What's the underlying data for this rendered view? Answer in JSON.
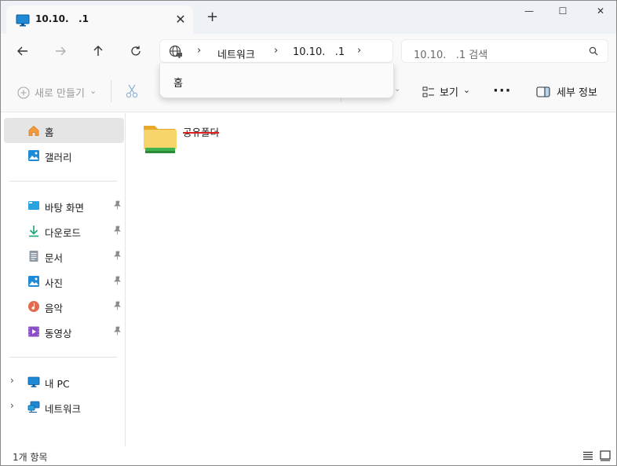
{
  "window": {
    "tab_title": "10.10.   .1",
    "tab_close": "✕",
    "new_tab": "+",
    "minimize": "—",
    "maximize": "☐",
    "close": "✕"
  },
  "nav": {
    "breadcrumbs": [
      "네트워크",
      "10.10.   .1"
    ],
    "separators": [
      "›",
      "›",
      "›"
    ],
    "search_placeholder": "10.10.   .1 검색"
  },
  "toolbar": {
    "new_label": "새로 만들기",
    "new_chevron": "⌄",
    "hidden_chevron": "⌄",
    "view_label": "보기",
    "view_chevron": "⌄",
    "more_label": "···",
    "details_label": "세부 정보"
  },
  "dropdown": {
    "items": [
      "홈"
    ]
  },
  "sidebar": {
    "items": [
      {
        "label": "홈",
        "icon": "home-icon"
      },
      {
        "label": "갤러리",
        "icon": "gallery-icon"
      },
      {
        "label": "바탕 화면",
        "icon": "desktop-icon",
        "pinned": true
      },
      {
        "label": "다운로드",
        "icon": "download-icon",
        "pinned": true
      },
      {
        "label": "문서",
        "icon": "document-icon",
        "pinned": true
      },
      {
        "label": "사진",
        "icon": "pictures-icon",
        "pinned": true
      },
      {
        "label": "음악",
        "icon": "music-icon",
        "pinned": true
      },
      {
        "label": "동영상",
        "icon": "video-icon",
        "pinned": true
      },
      {
        "label": "내 PC",
        "icon": "pc-icon"
      },
      {
        "label": "네트워크",
        "icon": "network-icon"
      }
    ],
    "expand_glyph": "›"
  },
  "content": {
    "items": [
      {
        "name": "공유폴더",
        "icon": "shared-folder-icon"
      }
    ]
  },
  "status": {
    "item_count": "1개 항목"
  },
  "colors": {
    "accent": "#0067c0",
    "folder": "#f8c94b",
    "strike": "#e02020",
    "selected_bg": "#e5e5e5"
  }
}
